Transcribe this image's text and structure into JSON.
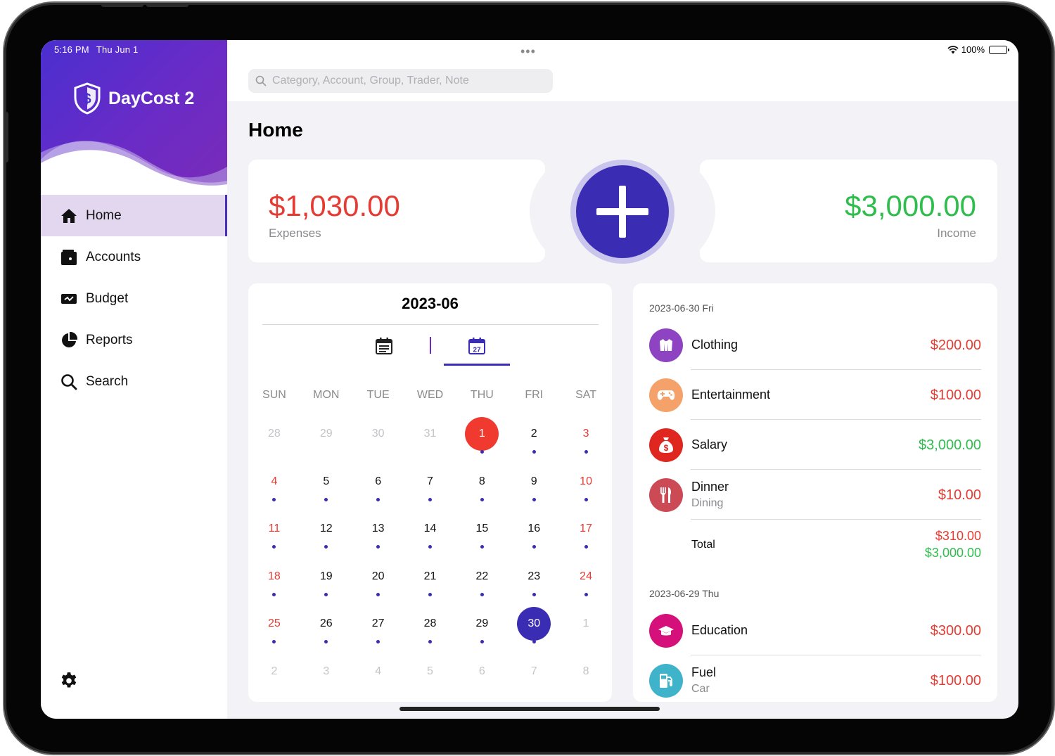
{
  "status_bar": {
    "time": "5:16 PM",
    "date": "Thu Jun 1",
    "battery": "100%"
  },
  "app": {
    "name": "DayCost 2"
  },
  "sidebar": {
    "items": [
      {
        "label": "Home",
        "icon": "home-icon",
        "active": true
      },
      {
        "label": "Accounts",
        "icon": "wallet-icon"
      },
      {
        "label": "Budget",
        "icon": "budget-icon"
      },
      {
        "label": "Reports",
        "icon": "pie-chart-icon"
      },
      {
        "label": "Search",
        "icon": "search-icon"
      }
    ]
  },
  "search": {
    "placeholder": "Category, Account, Group, Trader, Note"
  },
  "page": {
    "title": "Home"
  },
  "summary": {
    "expenses_amount": "$1,030.00",
    "expenses_label": "Expenses",
    "income_amount": "$3,000.00",
    "income_label": "Income"
  },
  "calendar": {
    "month": "2023-06",
    "weekdays": [
      "SUN",
      "MON",
      "TUE",
      "WED",
      "THU",
      "FRI",
      "SAT"
    ],
    "weeks": [
      [
        {
          "d": "28",
          "o": true
        },
        {
          "d": "29",
          "o": true
        },
        {
          "d": "30",
          "o": true
        },
        {
          "d": "31",
          "o": true
        },
        {
          "d": "1",
          "today": true,
          "dot": true
        },
        {
          "d": "2",
          "dot": true
        },
        {
          "d": "3",
          "dot": true
        }
      ],
      [
        {
          "d": "4",
          "dot": true
        },
        {
          "d": "5",
          "dot": true
        },
        {
          "d": "6",
          "dot": true
        },
        {
          "d": "7",
          "dot": true
        },
        {
          "d": "8",
          "dot": true
        },
        {
          "d": "9",
          "dot": true
        },
        {
          "d": "10",
          "dot": true
        }
      ],
      [
        {
          "d": "11",
          "dot": true
        },
        {
          "d": "12",
          "dot": true
        },
        {
          "d": "13",
          "dot": true
        },
        {
          "d": "14",
          "dot": true
        },
        {
          "d": "15",
          "dot": true
        },
        {
          "d": "16",
          "dot": true
        },
        {
          "d": "17",
          "dot": true
        }
      ],
      [
        {
          "d": "18",
          "dot": true
        },
        {
          "d": "19",
          "dot": true
        },
        {
          "d": "20",
          "dot": true
        },
        {
          "d": "21",
          "dot": true
        },
        {
          "d": "22",
          "dot": true
        },
        {
          "d": "23",
          "dot": true
        },
        {
          "d": "24",
          "dot": true
        }
      ],
      [
        {
          "d": "25",
          "dot": true
        },
        {
          "d": "26",
          "dot": true
        },
        {
          "d": "27",
          "dot": true
        },
        {
          "d": "28",
          "dot": true
        },
        {
          "d": "29",
          "dot": true
        },
        {
          "d": "30",
          "selected": true,
          "dot": true
        },
        {
          "d": "1",
          "o": true
        }
      ],
      [
        {
          "d": "2",
          "o": true
        },
        {
          "d": "3",
          "o": true
        },
        {
          "d": "4",
          "o": true
        },
        {
          "d": "5",
          "o": true
        },
        {
          "d": "6",
          "o": true
        },
        {
          "d": "7",
          "o": true
        },
        {
          "d": "8",
          "o": true
        }
      ]
    ]
  },
  "transactions": {
    "groups": [
      {
        "date": "2023-06-30 Fri",
        "items": [
          {
            "title": "Clothing",
            "amount": "$200.00",
            "type": "expense",
            "icon": "clothing-icon",
            "color": "#8e44c2"
          },
          {
            "title": "Entertainment",
            "amount": "$100.00",
            "type": "expense",
            "icon": "gamepad-icon",
            "color": "#f5a26a"
          },
          {
            "title": "Salary",
            "amount": "$3,000.00",
            "type": "income",
            "icon": "money-bag-icon",
            "color": "#e0271f"
          },
          {
            "title": "Dinner",
            "subtitle": "Dining",
            "amount": "$10.00",
            "type": "expense",
            "icon": "utensils-icon",
            "color": "#cc4a55"
          }
        ],
        "total_label": "Total",
        "total_expense": "$310.00",
        "total_income": "$3,000.00"
      },
      {
        "date": "2023-06-29 Thu",
        "items": [
          {
            "title": "Education",
            "amount": "$300.00",
            "type": "expense",
            "icon": "graduation-cap-icon",
            "color": "#d6107a"
          },
          {
            "title": "Fuel",
            "subtitle": "Car",
            "amount": "$100.00",
            "type": "expense",
            "icon": "fuel-pump-icon",
            "color": "#3fb3c9"
          }
        ]
      }
    ]
  }
}
